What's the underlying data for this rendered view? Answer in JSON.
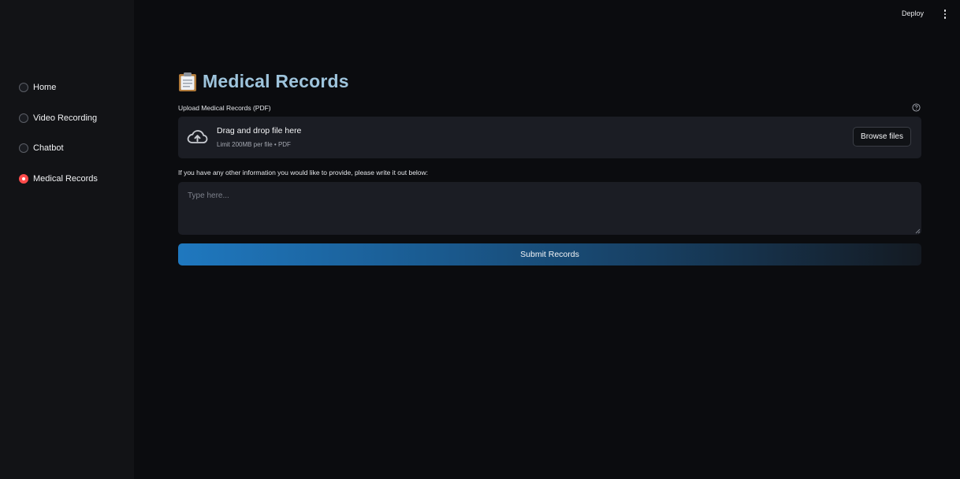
{
  "sidebar": {
    "items": [
      {
        "label": "Home",
        "selected": false
      },
      {
        "label": "Video Recording",
        "selected": false
      },
      {
        "label": "Chatbot",
        "selected": false
      },
      {
        "label": "Medical Records",
        "selected": true
      }
    ]
  },
  "topbar": {
    "deploy_label": "Deploy",
    "menu_icon": "kebab-menu-icon"
  },
  "main": {
    "title": "Medical Records",
    "title_icon": "clipboard-icon",
    "upload": {
      "label": "Upload Medical Records (PDF)",
      "dropzone_title": "Drag and drop file here",
      "dropzone_subtitle": "Limit 200MB per file • PDF",
      "browse_label": "Browse files",
      "help_icon": "help-circle-icon"
    },
    "info": {
      "label": "If you have any other information you would like to provide, please write it out below:",
      "placeholder": "Type here...",
      "value": ""
    },
    "submit_label": "Submit Records"
  },
  "colors": {
    "background": "#0b0c0f",
    "sidebar": "#121316",
    "accent_red": "#ff4b4b",
    "title": "#9ec4dc",
    "button_blue": "#1f78bf"
  }
}
